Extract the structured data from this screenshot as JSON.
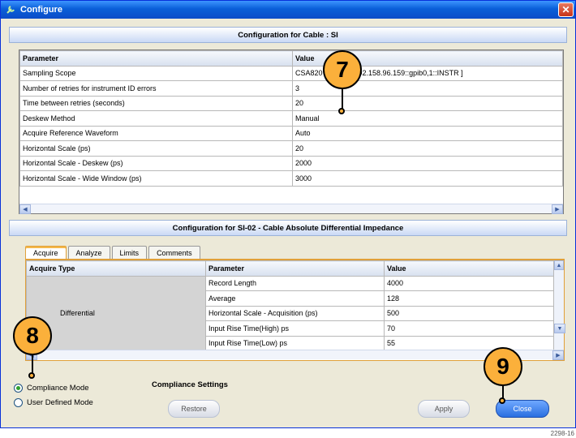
{
  "window": {
    "title": "Configure",
    "close_glyph": "✕"
  },
  "cable_config": {
    "header": "Configuration for Cable : SI",
    "columns": [
      "Parameter",
      "Value"
    ],
    "rows": [
      [
        "Sampling Scope",
        "CSA820",
        "92.158.96.159::gpib0,1::INSTR ]"
      ],
      [
        "Number of retries for instrument ID errors",
        "3"
      ],
      [
        "Time between retries (seconds)",
        "20"
      ],
      [
        "Deskew Method",
        "Manual"
      ],
      [
        "Acquire Reference Waveform",
        "Auto"
      ],
      [
        "Horizontal Scale (ps)",
        "20"
      ],
      [
        "Horizontal Scale - Deskew (ps)",
        "2000"
      ],
      [
        "Horizontal Scale - Wide Window (ps)",
        "3000"
      ]
    ]
  },
  "measurement_config": {
    "header": "Configuration for SI-02 - Cable Absolute Differential Impedance",
    "tabs": [
      "Acquire",
      "Analyze",
      "Limits",
      "Comments"
    ],
    "active_tab": "Acquire",
    "columns": [
      "Acquire Type",
      "Parameter",
      "Value"
    ],
    "acquire_type_value": "Differential",
    "rows": [
      [
        "Record Length",
        "4000"
      ],
      [
        "Average",
        "128"
      ],
      [
        "Horizontal Scale - Acquisition (ps)",
        "500"
      ],
      [
        "Input Rise Time(High) ps",
        "70"
      ],
      [
        "Input Rise Time(Low) ps",
        "55"
      ]
    ]
  },
  "mode": {
    "compliance_label": "Compliance Mode",
    "user_defined_label": "User Defined Mode",
    "selected": "Compliance Mode"
  },
  "compliance_settings": {
    "label": "Compliance Settings",
    "restore_label": "Restore",
    "apply_label": "Apply",
    "close_label": "Close"
  },
  "callouts": {
    "c7": "7",
    "c8": "8",
    "c9": "9"
  },
  "figure_code": "2298-16"
}
